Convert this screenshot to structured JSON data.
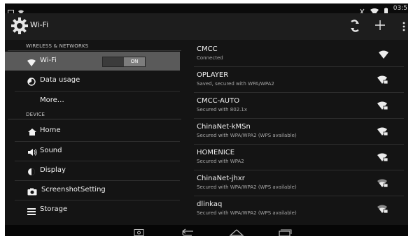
{
  "statusbar": {
    "time": "03:5"
  },
  "actionbar": {
    "title": "Wi-Fi"
  },
  "left": {
    "wireless_header": "WIRELESS & NETWORKS",
    "wifi_label": "Wi-Fi",
    "wifi_toggle": "ON",
    "data_usage": "Data usage",
    "more": "More…",
    "device_header": "DEVICE",
    "home": "Home",
    "sound": "Sound",
    "display": "Display",
    "screenshot": "ScreenshotSetting",
    "storage": "Storage"
  },
  "networks": [
    {
      "name": "CMCC",
      "status": "Connected",
      "icon": "wifi-full-icon"
    },
    {
      "name": "OPLAYER",
      "status": "Saved, secured with WPA/WPA2",
      "icon": "wifi-lock-icon"
    },
    {
      "name": "CMCC-AUTO",
      "status": "Secured with 802.1x",
      "icon": "wifi-lock-icon"
    },
    {
      "name": "ChinaNet-kMSn",
      "status": "Secured with WPA/WPA2 (WPS available)",
      "icon": "wifi-lock-icon"
    },
    {
      "name": "HOMENICE",
      "status": "Secured with WPA2",
      "icon": "wifi-lock-icon"
    },
    {
      "name": "ChinaNet-jhxr",
      "status": "Secured with WPA/WPA2 (WPS available)",
      "icon": "wifi-lock-icon"
    },
    {
      "name": "dlinkaq",
      "status": "Secured with WPA/WPA2 (WPS available)",
      "icon": "wifi-lock-icon"
    }
  ]
}
